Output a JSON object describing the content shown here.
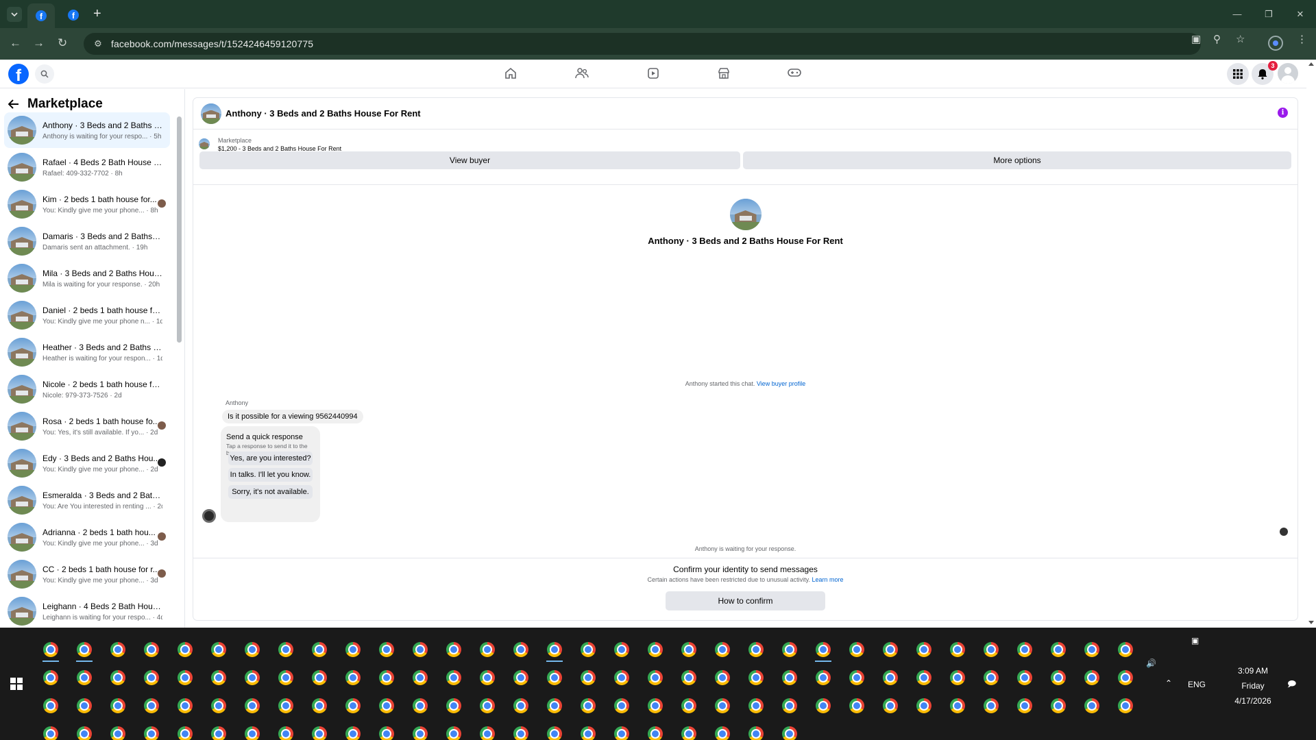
{
  "browser": {
    "url": "facebook.com/messages/t/1524246459120775",
    "new_tab": "+"
  },
  "header": {
    "notification_count": "3",
    "logo_letter": "f"
  },
  "sidebar": {
    "title": "Marketplace",
    "conversations": [
      {
        "title": "Anthony · 3 Beds and 2 Baths H...",
        "subtitle": "Anthony is waiting for your respo... · 5h",
        "selected": true
      },
      {
        "title": "Rafael · 4 Beds 2 Bath House Fo...",
        "subtitle": "Rafael: 409-332-7702 · 8h"
      },
      {
        "title": "Kim · 2 beds 1 bath house for...",
        "subtitle": "You: Kindly give me your phone... · 8h"
      },
      {
        "title": "Damaris · 3 Beds and 2 Baths H...",
        "subtitle": "Damaris sent an attachment. · 19h"
      },
      {
        "title": "Mila · 3 Beds and 2 Baths Hous...",
        "subtitle": "Mila is waiting for your response. · 20h"
      },
      {
        "title": "Daniel · 2 beds 1 bath house for...",
        "subtitle": "You: Kindly give me your phone n... · 1d"
      },
      {
        "title": "Heather · 3 Beds and 2 Baths H...",
        "subtitle": "Heather is waiting for your respon... · 1d"
      },
      {
        "title": "Nicole · 2 beds 1 bath house for...",
        "subtitle": "Nicole: 979-373-7526 · 2d"
      },
      {
        "title": "Rosa · 2 beds 1 bath house fo...",
        "subtitle": "You: Yes, it's still available. If yo... · 2d"
      },
      {
        "title": "Edy · 3 Beds and 2 Baths Hou...",
        "subtitle": "You: Kindly give me your phone... · 2d"
      },
      {
        "title": "Esmeralda · 3 Beds and 2 Baths ...",
        "subtitle": "You: Are You interested in renting ... · 2d"
      },
      {
        "title": "Adrianna · 2 beds 1 bath hou...",
        "subtitle": "You: Kindly give me your phone... · 3d"
      },
      {
        "title": "CC · 2 beds 1 bath house for r...",
        "subtitle": "You: Kindly give me your phone... · 3d"
      },
      {
        "title": "Leighann · 4 Beds 2 Bath House...",
        "subtitle": "Leighann is waiting for your respo... · 4d"
      }
    ]
  },
  "chat": {
    "title": "Anthony · 3 Beds and 2 Baths House For Rent",
    "marketplace_label": "Marketplace",
    "listing": "$1,200 - 3 Beds and 2 Baths House For Rent",
    "view_buyer": "View buyer",
    "more_options": "More options",
    "thread_title": "Anthony · 3 Beds and 2 Baths House For Rent",
    "started_text": "Anthony started this chat. ",
    "started_link": "View buyer profile",
    "sender": "Anthony",
    "message": "Is it possible for a viewing 9562440994",
    "quick_title": "Send a quick response",
    "quick_sub": "Tap a response to send it to the buyer.",
    "quick_replies": [
      "Yes, are you interested?",
      "In talks. I'll let you know.",
      "Sorry, it's not available."
    ],
    "waiting": "Anthony is waiting for your response.",
    "confirm_title": "Confirm your identity to send messages",
    "confirm_sub": "Certain actions have been restricted due to unusual activity. ",
    "learn_more": "Learn more",
    "how_to_confirm": "How to confirm"
  },
  "taskbar": {
    "lang": "ENG",
    "time": "3:09 AM",
    "day": "Friday",
    "date": "4/17/2026"
  },
  "colors": {
    "facebook_blue": "#0866ff",
    "link_blue": "#0064d1",
    "selected_row": "#ebf5ff",
    "chrome_frame": "#1f3a2c",
    "info_purple": "#9a1aeb"
  }
}
